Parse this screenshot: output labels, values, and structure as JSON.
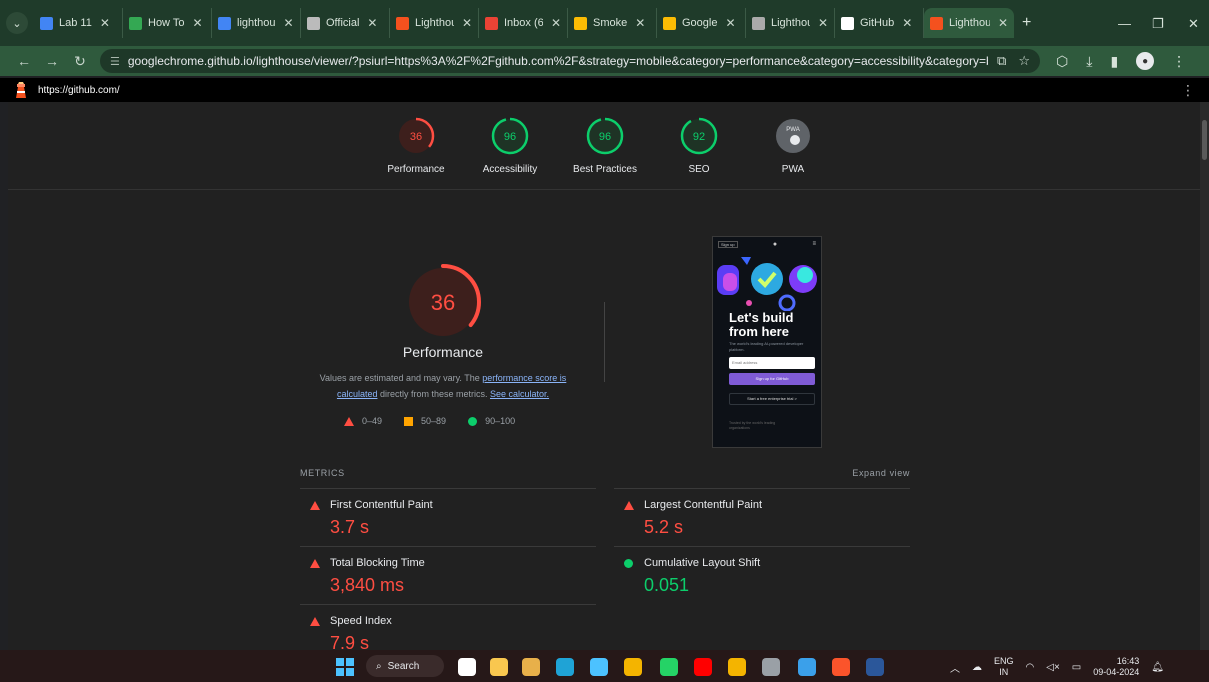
{
  "browser": {
    "tabs": [
      {
        "title": "Lab 11",
        "icon": "doc-icon",
        "color": "#4285f4"
      },
      {
        "title": "How To",
        "icon": "leaf-icon",
        "color": "#34a853"
      },
      {
        "title": "lighthou",
        "icon": "book-icon",
        "color": "#4285f4"
      },
      {
        "title": "Official",
        "icon": "grid-icon",
        "color": "#bbbbbb"
      },
      {
        "title": "Lighthou",
        "icon": "lighthouse-icon",
        "color": "#f4511e"
      },
      {
        "title": "Inbox (6",
        "icon": "gmail-icon",
        "color": "#ea4335"
      },
      {
        "title": "Smoke",
        "icon": "drive-icon",
        "color": "#fbbc04"
      },
      {
        "title": "Google",
        "icon": "drive-icon",
        "color": "#fbbc04"
      },
      {
        "title": "Lighthou",
        "icon": "image-icon",
        "color": "#aaaaaa"
      },
      {
        "title": "GitHub",
        "icon": "github-icon",
        "color": "#ffffff"
      },
      {
        "title": "Lighthou",
        "icon": "lighthouse-icon",
        "color": "#f4511e"
      }
    ],
    "address": "googlechrome.github.io/lighthouse/viewer/?psiurl=https%3A%2F%2Fgithub.com%2F&strategy=mobile&category=performance&category=accessibility&category=best-practi..."
  },
  "report": {
    "url": "https://github.com/",
    "categories": [
      {
        "label": "Performance",
        "score": "36",
        "value": 36,
        "color": "#ff4e42"
      },
      {
        "label": "Accessibility",
        "score": "96",
        "value": 96,
        "color": "#0cce6b"
      },
      {
        "label": "Best Practices",
        "score": "96",
        "value": 96,
        "color": "#0cce6b"
      },
      {
        "label": "SEO",
        "score": "92",
        "value": 92,
        "color": "#0cce6b"
      },
      {
        "label": "PWA",
        "score": "PWA",
        "value": 0,
        "color": "#9aa0a6"
      }
    ],
    "perf": {
      "score": "36",
      "value": 36,
      "title": "Performance",
      "desc_1": "Values are estimated and may vary. The ",
      "desc_link1": "performance score is calculated",
      "desc_2": " directly from these metrics. ",
      "desc_link2": "See calculator."
    },
    "legend": {
      "red": "0–49",
      "orange": "50–89",
      "green": "90–100"
    },
    "metrics_title": "METRICS",
    "expand_label": "Expand view",
    "metrics": [
      {
        "name": "First Contentful Paint",
        "value": "3.7 s",
        "status": "red"
      },
      {
        "name": "Largest Contentful Paint",
        "value": "5.2 s",
        "status": "red"
      },
      {
        "name": "Total Blocking Time",
        "value": "3,840 ms",
        "status": "red"
      },
      {
        "name": "Cumulative Layout Shift",
        "value": "0.051",
        "status": "green"
      },
      {
        "name": "Speed Index",
        "value": "7.9 s",
        "status": "red"
      }
    ],
    "screenshot": {
      "signup": "Sign up",
      "headline": "Let's build from here",
      "sub": "The world's leading AI-powered developer platform.",
      "email_placeholder": "Email address",
      "cta": "Sign up for GitHub",
      "cta2": "Start a free enterprise trial >",
      "foot": "Trusted by the world's leading organizations"
    }
  },
  "taskbar": {
    "search": "Search",
    "lang_1": "ENG",
    "lang_2": "IN",
    "time": "16:43",
    "date": "09-04-2024"
  }
}
